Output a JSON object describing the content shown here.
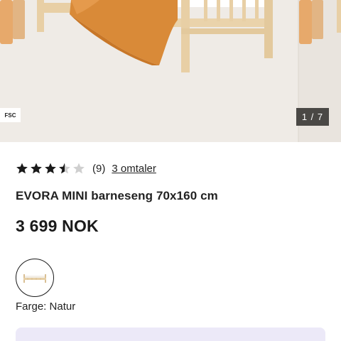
{
  "gallery": {
    "image_alt": "EVORA MINI barneseng med oransje sengetøy",
    "badge": "FSC",
    "counter": "1 / 7"
  },
  "rating": {
    "value": 3.5,
    "max": 5,
    "count_text": "(9)",
    "reviews_link": "3 omtaler",
    "star_color": "#1a1a1a",
    "empty_star_color": "#cfcfcf"
  },
  "product": {
    "title": "EVORA MINI barneseng 70x160 cm",
    "price": "3 699 NOK"
  },
  "variant": {
    "color_label": "Farge: Natur",
    "swatch_icon": "bed-thumbnail-icon"
  },
  "colors": {
    "gallery_bg": "#efebe6",
    "bedding": "#d98a38",
    "wood": "#e8cfa5",
    "banner_bg": "#ece9f8"
  }
}
